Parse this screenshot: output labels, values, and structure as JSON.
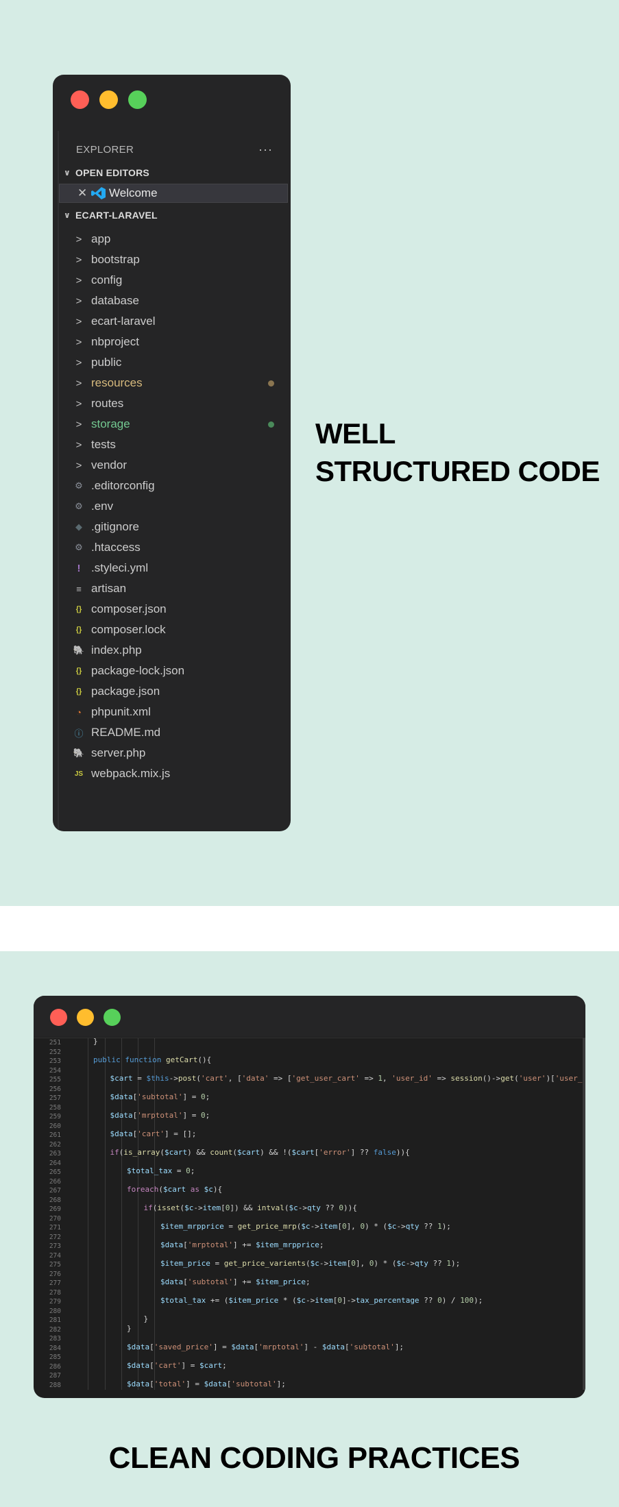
{
  "explorer_window": {
    "header_title": "EXPLORER",
    "header_more": "···",
    "open_editors_label": "OPEN EDITORS",
    "welcome_close": "✕",
    "welcome_tab": "Welcome",
    "project_label": "ECART-LARAVEL",
    "items": [
      {
        "label": "app",
        "icon": ">",
        "icon_name": "chevron-right-icon",
        "color": "#cccccc",
        "icon_color": "#c5c5c5"
      },
      {
        "label": "bootstrap",
        "icon": ">",
        "icon_name": "chevron-right-icon",
        "color": "#cccccc",
        "icon_color": "#c5c5c5"
      },
      {
        "label": "config",
        "icon": ">",
        "icon_name": "chevron-right-icon",
        "color": "#cccccc",
        "icon_color": "#c5c5c5"
      },
      {
        "label": "database",
        "icon": ">",
        "icon_name": "chevron-right-icon",
        "color": "#cccccc",
        "icon_color": "#c5c5c5"
      },
      {
        "label": "ecart-laravel",
        "icon": ">",
        "icon_name": "chevron-right-icon",
        "color": "#cccccc",
        "icon_color": "#c5c5c5"
      },
      {
        "label": "nbproject",
        "icon": ">",
        "icon_name": "chevron-right-icon",
        "color": "#cccccc",
        "icon_color": "#c5c5c5"
      },
      {
        "label": "public",
        "icon": ">",
        "icon_name": "chevron-right-icon",
        "color": "#cccccc",
        "icon_color": "#c5c5c5"
      },
      {
        "label": "resources",
        "icon": ">",
        "icon_name": "chevron-right-icon",
        "color": "#d7ba7d",
        "icon_color": "#c5c5c5",
        "status_dot": "#8a7550"
      },
      {
        "label": "routes",
        "icon": ">",
        "icon_name": "chevron-right-icon",
        "color": "#cccccc",
        "icon_color": "#c5c5c5"
      },
      {
        "label": "storage",
        "icon": ">",
        "icon_name": "chevron-right-icon",
        "color": "#73c991",
        "icon_color": "#c5c5c5",
        "status_dot": "#4a8a5a"
      },
      {
        "label": "tests",
        "icon": ">",
        "icon_name": "chevron-right-icon",
        "color": "#cccccc",
        "icon_color": "#c5c5c5"
      },
      {
        "label": "vendor",
        "icon": ">",
        "icon_name": "chevron-right-icon",
        "color": "#cccccc",
        "icon_color": "#c5c5c5"
      },
      {
        "label": ".editorconfig",
        "icon": "⚙",
        "icon_name": "gear-icon",
        "color": "#cccccc",
        "icon_color": "#8a8f99"
      },
      {
        "label": ".env",
        "icon": "⚙",
        "icon_name": "gear-icon",
        "color": "#cccccc",
        "icon_color": "#8a8f99"
      },
      {
        "label": ".gitignore",
        "icon": "◆",
        "icon_name": "git-icon",
        "color": "#cccccc",
        "icon_color": "#5a6a70"
      },
      {
        "label": ".htaccess",
        "icon": "⚙",
        "icon_name": "gear-icon",
        "color": "#cccccc",
        "icon_color": "#8a8f99"
      },
      {
        "label": ".styleci.yml",
        "icon": "!",
        "icon_name": "yaml-icon",
        "color": "#cccccc",
        "icon_color": "#a074c4"
      },
      {
        "label": "artisan",
        "icon": "≡",
        "icon_name": "text-file-icon",
        "color": "#cccccc",
        "icon_color": "#b8b8b8"
      },
      {
        "label": "composer.json",
        "icon": "{}",
        "icon_name": "json-icon",
        "color": "#cccccc",
        "icon_color": "#cbcb41"
      },
      {
        "label": "composer.lock",
        "icon": "{}",
        "icon_name": "json-icon",
        "color": "#cccccc",
        "icon_color": "#cbcb41"
      },
      {
        "label": "index.php",
        "icon": "🐘",
        "icon_name": "php-icon",
        "color": "#cccccc",
        "icon_color": "#a074c4"
      },
      {
        "label": "package-lock.json",
        "icon": "{}",
        "icon_name": "json-icon",
        "color": "#cccccc",
        "icon_color": "#cbcb41"
      },
      {
        "label": "package.json",
        "icon": "{}",
        "icon_name": "json-icon",
        "color": "#cccccc",
        "icon_color": "#cbcb41"
      },
      {
        "label": "phpunit.xml",
        "icon": "◔",
        "icon_name": "rss-icon",
        "color": "#cccccc",
        "icon_color": "#e37933"
      },
      {
        "label": "README.md",
        "icon": "ⓘ",
        "icon_name": "info-icon",
        "color": "#cccccc",
        "icon_color": "#519aba"
      },
      {
        "label": "server.php",
        "icon": "🐘",
        "icon_name": "php-icon",
        "color": "#cccccc",
        "icon_color": "#a074c4"
      },
      {
        "label": "webpack.mix.js",
        "icon": "JS",
        "icon_name": "javascript-icon",
        "color": "#cccccc",
        "icon_color": "#cbcb41"
      }
    ]
  },
  "headline_right": [
    "WELL",
    "STRUCTURED CODE"
  ],
  "headline_bottom": "CLEAN CODING PRACTICES",
  "window_dots": [
    "#ff5f56",
    "#ffbd2e",
    "#57d05a"
  ],
  "code_window": {
    "line_numbers": [
      251,
      252,
      253,
      254,
      255,
      256,
      257,
      258,
      259,
      260,
      261,
      262,
      263,
      264,
      265,
      266,
      267,
      268,
      269,
      270,
      271,
      272,
      273,
      274,
      275,
      276,
      277,
      278,
      279,
      280,
      281,
      282,
      283,
      284,
      285,
      286,
      287,
      288
    ],
    "lines": [
      {
        "n": 0,
        "indent": 0,
        "tokens": [
          [
            "}",
            "#d4d4d4"
          ]
        ]
      },
      {
        "n": 2,
        "indent": 0,
        "tokens": [
          [
            "public ",
            "#569cd6"
          ],
          [
            "function ",
            "#569cd6"
          ],
          [
            "getCart",
            "#dcdcaa"
          ],
          [
            "(){",
            "#d4d4d4"
          ]
        ]
      },
      {
        "n": 4,
        "indent": 1,
        "tokens": [
          [
            "$cart",
            "#9cdcfe"
          ],
          [
            " = ",
            "#d4d4d4"
          ],
          [
            "$this",
            "#569cd6"
          ],
          [
            "->",
            "#d4d4d4"
          ],
          [
            "post",
            "#dcdcaa"
          ],
          [
            "(",
            "#d4d4d4"
          ],
          [
            "'cart'",
            "#ce9178"
          ],
          [
            ", [",
            "#d4d4d4"
          ],
          [
            "'data'",
            "#ce9178"
          ],
          [
            " => [",
            "#d4d4d4"
          ],
          [
            "'get_user_cart'",
            "#ce9178"
          ],
          [
            " => ",
            "#d4d4d4"
          ],
          [
            "1",
            "#b5cea8"
          ],
          [
            ", ",
            "#d4d4d4"
          ],
          [
            "'user_id'",
            "#ce9178"
          ],
          [
            " => ",
            "#d4d4d4"
          ],
          [
            "session",
            "#dcdcaa"
          ],
          [
            "()->",
            "#d4d4d4"
          ],
          [
            "get",
            "#dcdcaa"
          ],
          [
            "(",
            "#d4d4d4"
          ],
          [
            "'user'",
            "#ce9178"
          ],
          [
            ")[",
            "#d4d4d4"
          ],
          [
            "'user_id'",
            "#ce9178"
          ],
          [
            "]]]);",
            "#d4d4d4"
          ]
        ]
      },
      {
        "n": 6,
        "indent": 1,
        "tokens": [
          [
            "$data",
            "#9cdcfe"
          ],
          [
            "[",
            "#d4d4d4"
          ],
          [
            "'subtotal'",
            "#ce9178"
          ],
          [
            "] = ",
            "#d4d4d4"
          ],
          [
            "0",
            "#b5cea8"
          ],
          [
            ";",
            "#d4d4d4"
          ]
        ]
      },
      {
        "n": 8,
        "indent": 1,
        "tokens": [
          [
            "$data",
            "#9cdcfe"
          ],
          [
            "[",
            "#d4d4d4"
          ],
          [
            "'mrptotal'",
            "#ce9178"
          ],
          [
            "] = ",
            "#d4d4d4"
          ],
          [
            "0",
            "#b5cea8"
          ],
          [
            ";",
            "#d4d4d4"
          ]
        ]
      },
      {
        "n": 10,
        "indent": 1,
        "tokens": [
          [
            "$data",
            "#9cdcfe"
          ],
          [
            "[",
            "#d4d4d4"
          ],
          [
            "'cart'",
            "#ce9178"
          ],
          [
            "] = [];",
            "#d4d4d4"
          ]
        ]
      },
      {
        "n": 12,
        "indent": 1,
        "tokens": [
          [
            "if",
            "#c586c0"
          ],
          [
            "(",
            "#d4d4d4"
          ],
          [
            "is_array",
            "#dcdcaa"
          ],
          [
            "(",
            "#d4d4d4"
          ],
          [
            "$cart",
            "#9cdcfe"
          ],
          [
            ") && ",
            "#d4d4d4"
          ],
          [
            "count",
            "#dcdcaa"
          ],
          [
            "(",
            "#d4d4d4"
          ],
          [
            "$cart",
            "#9cdcfe"
          ],
          [
            ") && !(",
            "#d4d4d4"
          ],
          [
            "$cart",
            "#9cdcfe"
          ],
          [
            "[",
            "#d4d4d4"
          ],
          [
            "'error'",
            "#ce9178"
          ],
          [
            "] ?? ",
            "#d4d4d4"
          ],
          [
            "false",
            "#569cd6"
          ],
          [
            ")){",
            "#d4d4d4"
          ]
        ]
      },
      {
        "n": 14,
        "indent": 2,
        "tokens": [
          [
            "$total_tax",
            "#9cdcfe"
          ],
          [
            " = ",
            "#d4d4d4"
          ],
          [
            "0",
            "#b5cea8"
          ],
          [
            ";",
            "#d4d4d4"
          ]
        ]
      },
      {
        "n": 16,
        "indent": 2,
        "tokens": [
          [
            "foreach",
            "#c586c0"
          ],
          [
            "(",
            "#d4d4d4"
          ],
          [
            "$cart",
            "#9cdcfe"
          ],
          [
            " as ",
            "#c586c0"
          ],
          [
            "$c",
            "#9cdcfe"
          ],
          [
            "){",
            "#d4d4d4"
          ]
        ]
      },
      {
        "n": 18,
        "indent": 3,
        "tokens": [
          [
            "if",
            "#c586c0"
          ],
          [
            "(",
            "#d4d4d4"
          ],
          [
            "isset",
            "#dcdcaa"
          ],
          [
            "(",
            "#d4d4d4"
          ],
          [
            "$c",
            "#9cdcfe"
          ],
          [
            "->",
            "#d4d4d4"
          ],
          [
            "item",
            "#9cdcfe"
          ],
          [
            "[",
            "#d4d4d4"
          ],
          [
            "0",
            "#b5cea8"
          ],
          [
            "]) && ",
            "#d4d4d4"
          ],
          [
            "intval",
            "#dcdcaa"
          ],
          [
            "(",
            "#d4d4d4"
          ],
          [
            "$c",
            "#9cdcfe"
          ],
          [
            "->",
            "#d4d4d4"
          ],
          [
            "qty",
            "#9cdcfe"
          ],
          [
            " ?? ",
            "#d4d4d4"
          ],
          [
            "0",
            "#b5cea8"
          ],
          [
            ")){",
            "#d4d4d4"
          ]
        ]
      },
      {
        "n": 20,
        "indent": 4,
        "tokens": [
          [
            "$item_mrpprice",
            "#9cdcfe"
          ],
          [
            " = ",
            "#d4d4d4"
          ],
          [
            "get_price_mrp",
            "#dcdcaa"
          ],
          [
            "(",
            "#d4d4d4"
          ],
          [
            "$c",
            "#9cdcfe"
          ],
          [
            "->",
            "#d4d4d4"
          ],
          [
            "item",
            "#9cdcfe"
          ],
          [
            "[",
            "#d4d4d4"
          ],
          [
            "0",
            "#b5cea8"
          ],
          [
            "], ",
            "#d4d4d4"
          ],
          [
            "0",
            "#b5cea8"
          ],
          [
            ") * (",
            "#d4d4d4"
          ],
          [
            "$c",
            "#9cdcfe"
          ],
          [
            "->",
            "#d4d4d4"
          ],
          [
            "qty",
            "#9cdcfe"
          ],
          [
            " ?? ",
            "#d4d4d4"
          ],
          [
            "1",
            "#b5cea8"
          ],
          [
            ");",
            "#d4d4d4"
          ]
        ]
      },
      {
        "n": 22,
        "indent": 4,
        "tokens": [
          [
            "$data",
            "#9cdcfe"
          ],
          [
            "[",
            "#d4d4d4"
          ],
          [
            "'mrptotal'",
            "#ce9178"
          ],
          [
            "] += ",
            "#d4d4d4"
          ],
          [
            "$item_mrpprice",
            "#9cdcfe"
          ],
          [
            ";",
            "#d4d4d4"
          ]
        ]
      },
      {
        "n": 24,
        "indent": 4,
        "tokens": [
          [
            "$item_price",
            "#9cdcfe"
          ],
          [
            " = ",
            "#d4d4d4"
          ],
          [
            "get_price_varients",
            "#dcdcaa"
          ],
          [
            "(",
            "#d4d4d4"
          ],
          [
            "$c",
            "#9cdcfe"
          ],
          [
            "->",
            "#d4d4d4"
          ],
          [
            "item",
            "#9cdcfe"
          ],
          [
            "[",
            "#d4d4d4"
          ],
          [
            "0",
            "#b5cea8"
          ],
          [
            "], ",
            "#d4d4d4"
          ],
          [
            "0",
            "#b5cea8"
          ],
          [
            ") * (",
            "#d4d4d4"
          ],
          [
            "$c",
            "#9cdcfe"
          ],
          [
            "->",
            "#d4d4d4"
          ],
          [
            "qty",
            "#9cdcfe"
          ],
          [
            " ?? ",
            "#d4d4d4"
          ],
          [
            "1",
            "#b5cea8"
          ],
          [
            ");",
            "#d4d4d4"
          ]
        ]
      },
      {
        "n": 26,
        "indent": 4,
        "tokens": [
          [
            "$data",
            "#9cdcfe"
          ],
          [
            "[",
            "#d4d4d4"
          ],
          [
            "'subtotal'",
            "#ce9178"
          ],
          [
            "] += ",
            "#d4d4d4"
          ],
          [
            "$item_price",
            "#9cdcfe"
          ],
          [
            ";",
            "#d4d4d4"
          ]
        ]
      },
      {
        "n": 28,
        "indent": 4,
        "tokens": [
          [
            "$total_tax",
            "#9cdcfe"
          ],
          [
            " += (",
            "#d4d4d4"
          ],
          [
            "$item_price",
            "#9cdcfe"
          ],
          [
            " * (",
            "#d4d4d4"
          ],
          [
            "$c",
            "#9cdcfe"
          ],
          [
            "->",
            "#d4d4d4"
          ],
          [
            "item",
            "#9cdcfe"
          ],
          [
            "[",
            "#d4d4d4"
          ],
          [
            "0",
            "#b5cea8"
          ],
          [
            "]->",
            "#d4d4d4"
          ],
          [
            "tax_percentage",
            "#9cdcfe"
          ],
          [
            " ?? ",
            "#d4d4d4"
          ],
          [
            "0",
            "#b5cea8"
          ],
          [
            ") / ",
            "#d4d4d4"
          ],
          [
            "100",
            "#b5cea8"
          ],
          [
            ");",
            "#d4d4d4"
          ]
        ]
      },
      {
        "n": 30,
        "indent": 3,
        "tokens": [
          [
            "}",
            "#d4d4d4"
          ]
        ]
      },
      {
        "n": 31,
        "indent": 2,
        "tokens": [
          [
            "}",
            "#d4d4d4"
          ]
        ]
      },
      {
        "n": 33,
        "indent": 2,
        "tokens": [
          [
            "$data",
            "#9cdcfe"
          ],
          [
            "[",
            "#d4d4d4"
          ],
          [
            "'saved_price'",
            "#ce9178"
          ],
          [
            "] = ",
            "#d4d4d4"
          ],
          [
            "$data",
            "#9cdcfe"
          ],
          [
            "[",
            "#d4d4d4"
          ],
          [
            "'mrptotal'",
            "#ce9178"
          ],
          [
            "] - ",
            "#d4d4d4"
          ],
          [
            "$data",
            "#9cdcfe"
          ],
          [
            "[",
            "#d4d4d4"
          ],
          [
            "'subtotal'",
            "#ce9178"
          ],
          [
            "];",
            "#d4d4d4"
          ]
        ]
      },
      {
        "n": 35,
        "indent": 2,
        "tokens": [
          [
            "$data",
            "#9cdcfe"
          ],
          [
            "[",
            "#d4d4d4"
          ],
          [
            "'cart'",
            "#ce9178"
          ],
          [
            "] = ",
            "#d4d4d4"
          ],
          [
            "$cart",
            "#9cdcfe"
          ],
          [
            ";",
            "#d4d4d4"
          ]
        ]
      },
      {
        "n": 37,
        "indent": 2,
        "tokens": [
          [
            "$data",
            "#9cdcfe"
          ],
          [
            "[",
            "#d4d4d4"
          ],
          [
            "'total'",
            "#ce9178"
          ],
          [
            "] = ",
            "#d4d4d4"
          ],
          [
            "$data",
            "#9cdcfe"
          ],
          [
            "[",
            "#d4d4d4"
          ],
          [
            "'subtotal'",
            "#ce9178"
          ],
          [
            "];",
            "#d4d4d4"
          ]
        ]
      }
    ]
  }
}
